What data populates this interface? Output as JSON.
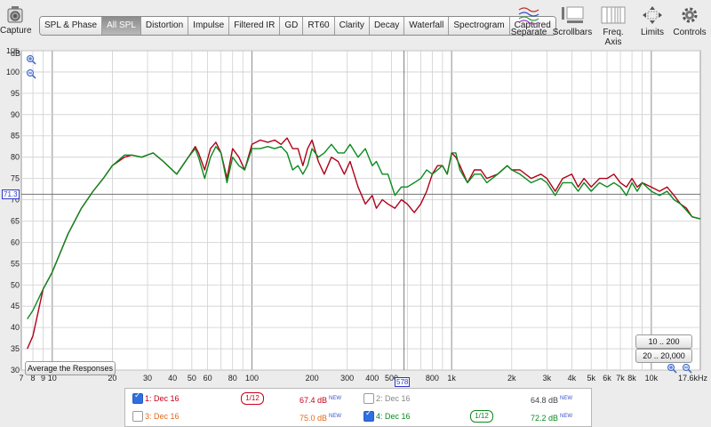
{
  "toolbar": {
    "capture_label": "Capture",
    "tabs": [
      {
        "label": "SPL & Phase",
        "active": false
      },
      {
        "label": "All SPL",
        "active": true
      },
      {
        "label": "Distortion",
        "active": false
      },
      {
        "label": "Impulse",
        "active": false
      },
      {
        "label": "Filtered IR",
        "active": false
      },
      {
        "label": "GD",
        "active": false
      },
      {
        "label": "RT60",
        "active": false
      },
      {
        "label": "Clarity",
        "active": false
      },
      {
        "label": "Decay",
        "active": false
      },
      {
        "label": "Waterfall",
        "active": false
      },
      {
        "label": "Spectrogram",
        "active": false
      },
      {
        "label": "Captured",
        "active": false
      }
    ],
    "tools": {
      "separate": "Separate",
      "scrollbars": "Scrollbars",
      "freq_axis": "Freq. Axis",
      "limits": "Limits",
      "controls": "Controls"
    }
  },
  "chart": {
    "average_button": "Average the Responses",
    "range_buttons": [
      "10 .. 200",
      "20 .. 20,000"
    ],
    "cursor_x_label": "578",
    "cursor_y_label": "71.3"
  },
  "chart_data": {
    "type": "line",
    "ylabel": "dB",
    "ylim": [
      30,
      105
    ],
    "xscale": "log",
    "xlim": [
      7,
      17600
    ],
    "yticks": [
      "30",
      "35",
      "40",
      "45",
      "50",
      "55",
      "60",
      "65",
      "70",
      "75",
      "80",
      "85",
      "90",
      "95",
      "100",
      "105"
    ],
    "xtick_labels": [
      {
        "f": 7,
        "label": "7"
      },
      {
        "f": 8,
        "label": "8"
      },
      {
        "f": 9,
        "label": "9"
      },
      {
        "f": 10,
        "label": "10"
      },
      {
        "f": 20,
        "label": "20"
      },
      {
        "f": 30,
        "label": "30"
      },
      {
        "f": 40,
        "label": "40"
      },
      {
        "f": 50,
        "label": "50"
      },
      {
        "f": 60,
        "label": "60"
      },
      {
        "f": 80,
        "label": "80"
      },
      {
        "f": 100,
        "label": "100"
      },
      {
        "f": 200,
        "label": "200"
      },
      {
        "f": 300,
        "label": "300"
      },
      {
        "f": 400,
        "label": "400"
      },
      {
        "f": 500,
        "label": "500"
      },
      {
        "f": 800,
        "label": "800"
      },
      {
        "f": 1000,
        "label": "1k"
      },
      {
        "f": 2000,
        "label": "2k"
      },
      {
        "f": 3000,
        "label": "3k"
      },
      {
        "f": 4000,
        "label": "4k"
      },
      {
        "f": 5000,
        "label": "5k"
      },
      {
        "f": 6000,
        "label": "6k"
      },
      {
        "f": 7000,
        "label": "7k"
      },
      {
        "f": 8000,
        "label": "8k"
      },
      {
        "f": 10000,
        "label": "10k"
      },
      {
        "f": 17600,
        "label": "17.6kHz"
      }
    ],
    "cursor": {
      "x": 578,
      "y": 71.3
    },
    "series": [
      {
        "color": "#b0001a",
        "x": [
          7.5,
          8,
          9,
          10,
          12,
          14,
          16,
          18,
          20,
          23,
          25,
          28,
          32,
          36,
          42,
          48,
          52,
          54,
          58,
          62,
          66,
          70,
          75,
          80,
          86,
          92,
          100,
          110,
          120,
          130,
          140,
          150,
          160,
          170,
          180,
          190,
          200,
          215,
          230,
          250,
          270,
          290,
          310,
          340,
          370,
          400,
          420,
          450,
          480,
          520,
          560,
          600,
          650,
          700,
          750,
          800,
          850,
          900,
          950,
          1000,
          1050,
          1100,
          1200,
          1300,
          1400,
          1500,
          1700,
          1900,
          2000,
          2200,
          2500,
          2800,
          3000,
          3300,
          3600,
          4000,
          4300,
          4600,
          5000,
          5500,
          6000,
          6500,
          7000,
          7500,
          8000,
          8500,
          9000,
          10000,
          11000,
          12000,
          13000,
          14000,
          15000,
          16000,
          17600
        ],
        "y": [
          35,
          38,
          49,
          53,
          62,
          68,
          72,
          75,
          78,
          80,
          80.5,
          80,
          81,
          79,
          76,
          80,
          82.5,
          81,
          77,
          82,
          83.5,
          81,
          75,
          82,
          80,
          77,
          83,
          84,
          83.5,
          84,
          83,
          84.5,
          82,
          82,
          78,
          82,
          84,
          79,
          76,
          80,
          79,
          76,
          79,
          73,
          69,
          71,
          68,
          70,
          69,
          68,
          70,
          69,
          67,
          69,
          72,
          76,
          78,
          78,
          76,
          81,
          80,
          78,
          74,
          77,
          77,
          75,
          76,
          78,
          77,
          77,
          75,
          76,
          75,
          72,
          75,
          76,
          73,
          75,
          73,
          75,
          75,
          76,
          74,
          73,
          75,
          73,
          74,
          73,
          72,
          73,
          71,
          69,
          68,
          66,
          65.5
        ]
      },
      {
        "color": "#0a8a1e",
        "x": [
          7.5,
          8,
          9,
          10,
          12,
          14,
          16,
          18,
          20,
          23,
          25,
          28,
          32,
          36,
          42,
          48,
          52,
          54,
          58,
          62,
          66,
          70,
          75,
          80,
          86,
          92,
          100,
          110,
          120,
          130,
          140,
          150,
          160,
          170,
          180,
          190,
          200,
          215,
          230,
          250,
          270,
          290,
          310,
          340,
          370,
          400,
          420,
          450,
          480,
          520,
          560,
          600,
          650,
          700,
          750,
          800,
          850,
          900,
          950,
          1000,
          1050,
          1100,
          1200,
          1300,
          1400,
          1500,
          1700,
          1900,
          2000,
          2200,
          2500,
          2800,
          3000,
          3300,
          3600,
          4000,
          4300,
          4600,
          5000,
          5500,
          6000,
          6500,
          7000,
          7500,
          8000,
          8500,
          9000,
          10000,
          11000,
          12000,
          13000,
          14000,
          15000,
          16000,
          17600
        ],
        "y": [
          42,
          44,
          49,
          53,
          62,
          68,
          72,
          75,
          78,
          80.5,
          80.5,
          80,
          81,
          79,
          76,
          80,
          82,
          80,
          75,
          80,
          82.5,
          81,
          74,
          80,
          78,
          77,
          82,
          82,
          82.5,
          82,
          82.5,
          81,
          77,
          78,
          76,
          78,
          82,
          80,
          81,
          83,
          81,
          81,
          83,
          80,
          82,
          78,
          79,
          76,
          76,
          71,
          73,
          73,
          74,
          75,
          77,
          76,
          77,
          78,
          76,
          81,
          81,
          77,
          74,
          76,
          76,
          74,
          76,
          78,
          77,
          76,
          74,
          75,
          74,
          71,
          74,
          74,
          72,
          74,
          72,
          74,
          73,
          74,
          73,
          71,
          74,
          72,
          74,
          72,
          71,
          72,
          70,
          69,
          67.5,
          66,
          65.5
        ]
      }
    ]
  },
  "legend": {
    "rows": [
      {
        "left": {
          "checked": true,
          "label": "1: Dec 16",
          "color": "#c8001a",
          "smoothing": "1/12",
          "level": "67.4 dB",
          "badge": "NEW"
        },
        "right": {
          "checked": false,
          "label": "2: Dec 16",
          "color": "#888888",
          "smoothing": "",
          "level": "64.8 dB",
          "badge": "NEW"
        }
      },
      {
        "left": {
          "checked": false,
          "label": "3: Dec 16",
          "color": "#e06a1a",
          "smoothing": "",
          "level": "75.0 dB",
          "badge": "NEW"
        },
        "right": {
          "checked": true,
          "label": "4: Dec 16",
          "color": "#0a8a1e",
          "smoothing": "1/12",
          "level": "72.2 dB",
          "badge": "NEW"
        }
      }
    ]
  }
}
